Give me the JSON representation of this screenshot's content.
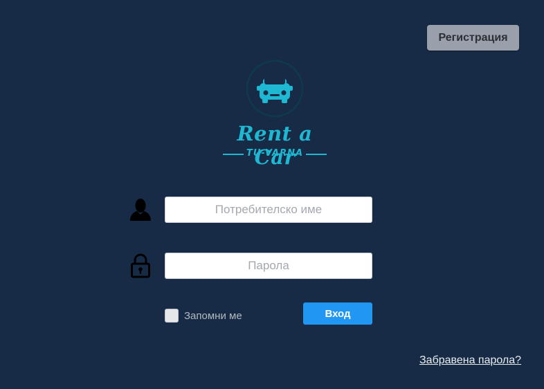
{
  "colors": {
    "background": "#172b47",
    "logo_accent": "#1fb8d2",
    "logo_ring": "#0f3a4c",
    "primary_button": "#2196f3",
    "register_button": "#9aa0ab"
  },
  "header": {
    "register_label": "Регистрация"
  },
  "logo": {
    "icon": "car-front-icon",
    "title": "Rent a Car",
    "subtitle": "TU-VARNA"
  },
  "login_form": {
    "username": {
      "icon": "user-icon",
      "placeholder": "Потребителско име",
      "value": ""
    },
    "password": {
      "icon": "lock-icon",
      "placeholder": "Парола",
      "value": ""
    },
    "remember_me": {
      "label": "Запомни ме",
      "checked": false
    },
    "submit_label": "Вход"
  },
  "footer": {
    "forgot_password_label": "Забравена парола?"
  }
}
